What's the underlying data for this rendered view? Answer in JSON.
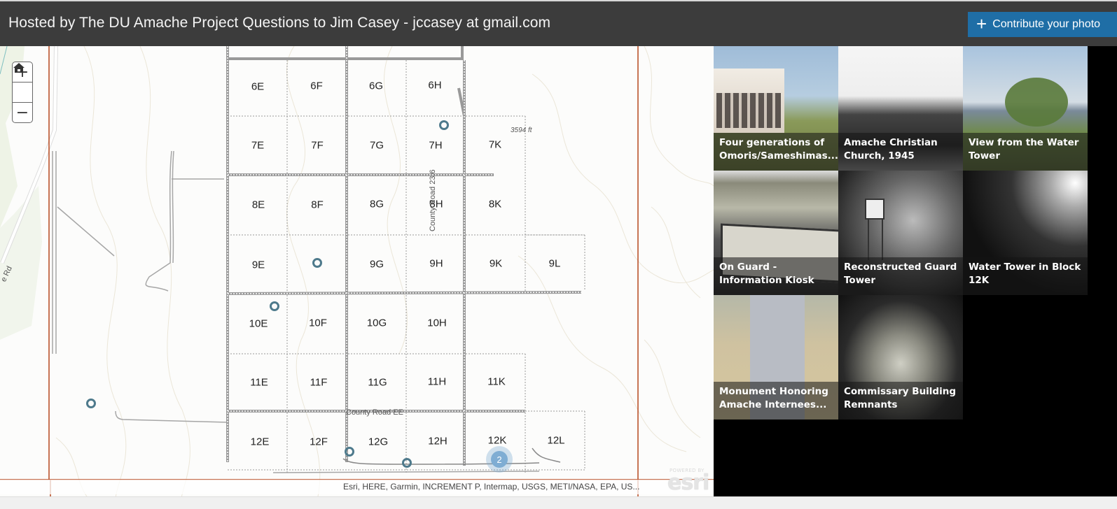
{
  "header": {
    "title": "Hosted by The DU Amache Project Questions to Jim Casey - jccasey at gmail.com",
    "contribute_label": "Contribute your photo",
    "contribute_icon": "plus-icon"
  },
  "colors": {
    "header_bg": "#3c3c3c",
    "accent": "#1f6ea6",
    "boundary": "#b5461c",
    "poi": "#4e7a8c",
    "cluster": "#7fadd3"
  },
  "map": {
    "zoom_in": "+",
    "home": "⌂",
    "zoom_out": "−",
    "blocks": [
      "6E",
      "6F",
      "6G",
      "6H",
      "7E",
      "7F",
      "7G",
      "7H",
      "7K",
      "8E",
      "8F",
      "8G",
      "8H",
      "8K",
      "9E",
      "9G",
      "9H",
      "9K",
      "9L",
      "10E",
      "10F",
      "10G",
      "10H",
      "11E",
      "11F",
      "11G",
      "11H",
      "11K",
      "12E",
      "12F",
      "12G",
      "12H",
      "12K",
      "12L"
    ],
    "road_labels": {
      "county_road_ee": "County Road EE",
      "county_road_23_6": "County Road 23.6",
      "left_road": "e Rd"
    },
    "elevation_label": "3594 ft",
    "cluster_count": "2",
    "attribution": "Esri, HERE, Garmin, INCREMENT P, Intermap, USGS, METI/NASA, EPA, US...",
    "logo_powered": "POWERED BY",
    "logo_text": "esri"
  },
  "gallery": {
    "tiles": [
      {
        "caption": "Four generations of Omoris/Sameshimas..."
      },
      {
        "caption": "Amache Christian Church, 1945"
      },
      {
        "caption": "View from the Water Tower"
      },
      {
        "caption": "On Guard - Information Kiosk"
      },
      {
        "caption": "Reconstructed Guard Tower"
      },
      {
        "caption": "Water Tower in Block 12K"
      },
      {
        "caption": "Monument Honoring Amache Internees..."
      },
      {
        "caption": "Commissary Building Remnants"
      }
    ]
  }
}
